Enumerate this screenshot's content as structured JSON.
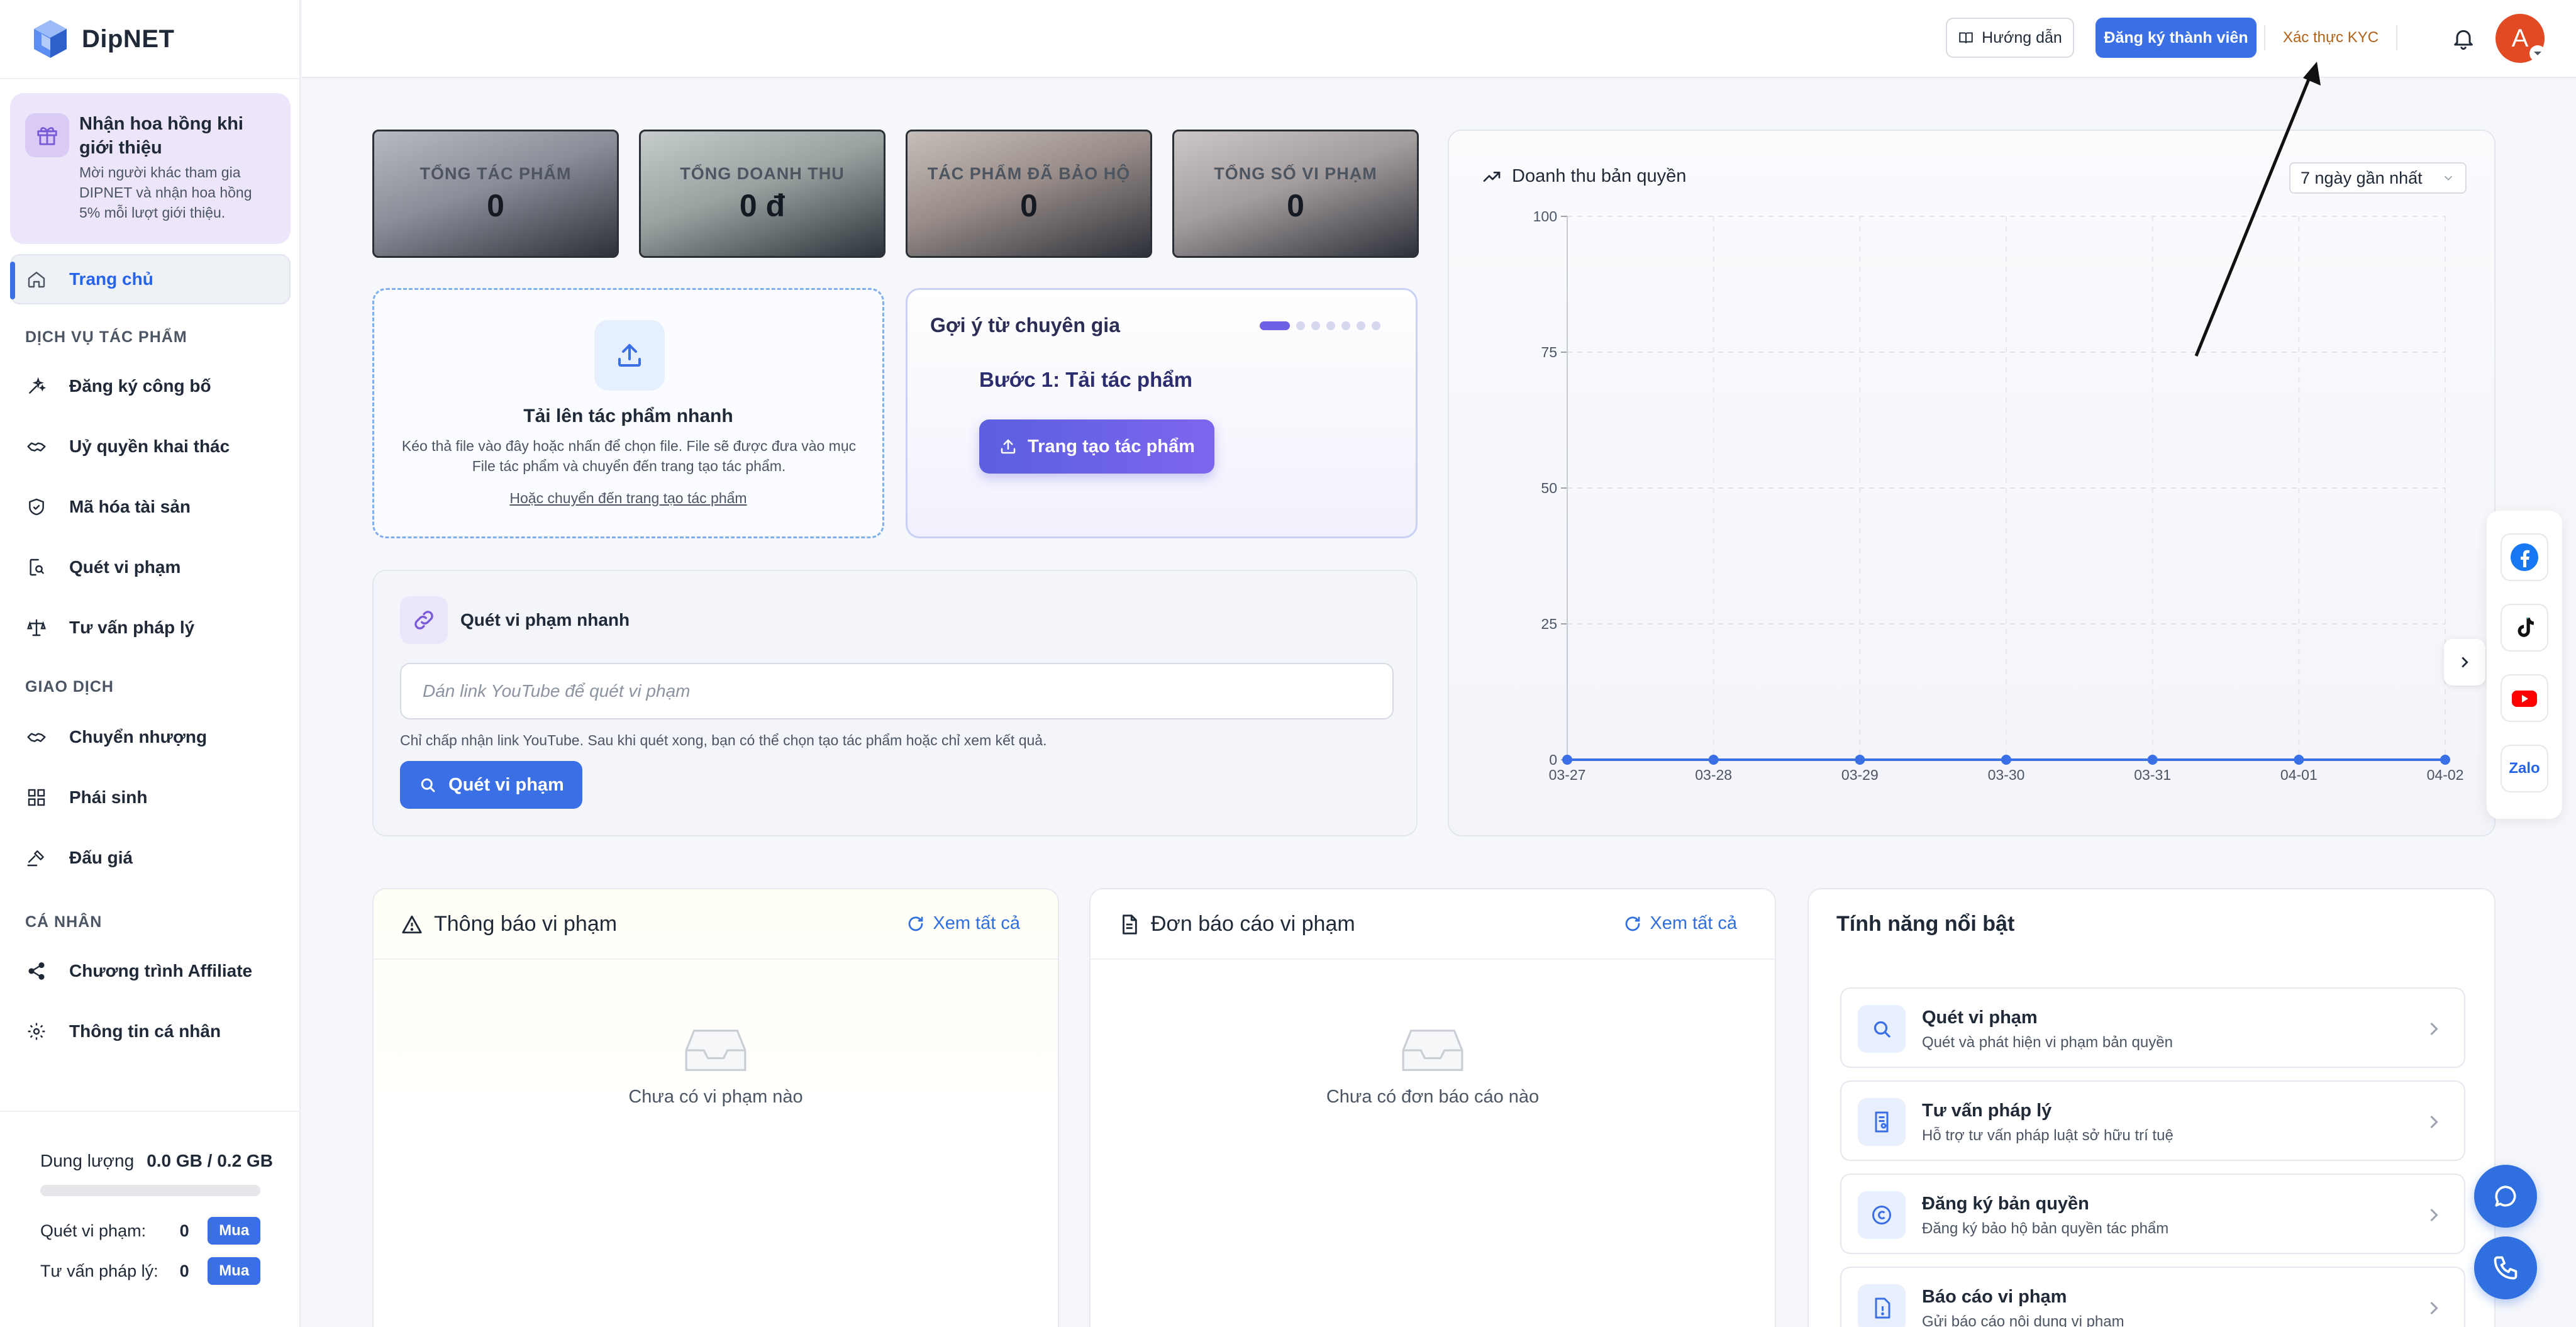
{
  "app": {
    "name": "DipNET"
  },
  "colors": {
    "primary": "#3b6fe6",
    "kyc": "#b0621a",
    "avatar": "#e24a24",
    "purple": "#6f61e6"
  },
  "sidebar": {
    "promo": {
      "title": "Nhận hoa hồng khi giới thiệu",
      "description": "Mời người khác tham gia DIPNET và nhận hoa hồng 5% mỗi lượt giới thiệu.",
      "icon": "gift-icon"
    },
    "home": {
      "label": "Trang chủ",
      "icon": "home-icon"
    },
    "sections": [
      {
        "title": "DỊCH VỤ TÁC PHẨM",
        "items": [
          {
            "label": "Đăng ký công bố",
            "icon": "sparkle-icon"
          },
          {
            "label": "Uỷ quyền khai thác",
            "icon": "handshake-icon"
          },
          {
            "label": "Mã hóa tài sản",
            "icon": "shield-icon"
          },
          {
            "label": "Quét vi phạm",
            "icon": "scan-icon"
          },
          {
            "label": "Tư vấn pháp lý",
            "icon": "scale-icon"
          }
        ]
      },
      {
        "title": "GIAO DỊCH",
        "items": [
          {
            "label": "Chuyển nhượng",
            "icon": "transfer-icon"
          },
          {
            "label": "Phái sinh",
            "icon": "grid-icon"
          },
          {
            "label": "Đấu giá",
            "icon": "gavel-icon"
          }
        ]
      },
      {
        "title": "CÁ NHÂN",
        "items": [
          {
            "label": "Chương trình Affiliate",
            "icon": "share-icon"
          },
          {
            "label": "Thông tin cá nhân",
            "icon": "gear-icon"
          }
        ]
      }
    ],
    "storage": {
      "label": "Dung lượng",
      "value": "0.0 GB / 0.2 GB",
      "used_fraction": 0.0
    },
    "quotas": [
      {
        "label": "Quét vi phạm:",
        "value": "0",
        "button": "Mua"
      },
      {
        "label": "Tư vấn pháp lý:",
        "value": "0",
        "button": "Mua"
      }
    ]
  },
  "topbar": {
    "guide_label": "Hướng dẫn",
    "register_label": "Đăng ký thành viên",
    "kyc_label": "Xác thực KYC",
    "avatar_letter": "A"
  },
  "stats": [
    {
      "label": "TỔNG TÁC PHẨM",
      "value": "0"
    },
    {
      "label": "TỔNG DOANH THU",
      "value": "0 đ"
    },
    {
      "label": "TÁC PHẨM ĐÃ BẢO HỘ",
      "value": "0"
    },
    {
      "label": "TỔNG SỐ VI PHẠM",
      "value": "0"
    }
  ],
  "upload": {
    "title": "Tải lên tác phẩm nhanh",
    "description": "Kéo thả file vào đây hoặc nhấn để chọn file. File sẽ được đưa vào mục File tác phẩm và chuyển đến trang tạo tác phẩm.",
    "link": "Hoặc chuyển đến trang tạo tác phẩm"
  },
  "expert": {
    "title": "Gợi ý từ chuyên gia",
    "step": "Bước 1: Tải tác phẩm",
    "button": "Trang tạo tác phẩm",
    "dots_total": 7,
    "dots_active": 0
  },
  "scan": {
    "title": "Quét vi phạm nhanh",
    "placeholder": "Dán link YouTube để quét vi phạm",
    "value": "",
    "hint": "Chỉ chấp nhận link YouTube. Sau khi quét xong, bạn có thể chọn tạo tác phẩm hoặc chỉ xem kết quả.",
    "button": "Quét vi phạm"
  },
  "chart": {
    "title": "Doanh thu bản quyền",
    "range_label": "7 ngày gần nhất"
  },
  "chart_data": {
    "type": "line",
    "title": "Doanh thu bản quyền",
    "x": [
      "03-27",
      "03-28",
      "03-29",
      "03-30",
      "03-31",
      "04-01",
      "04-02"
    ],
    "series": [
      {
        "values": [
          0,
          0,
          0,
          0,
          0,
          0,
          0
        ]
      }
    ],
    "ylim": [
      0,
      100
    ],
    "yticks": [
      0,
      25,
      50,
      75,
      100
    ],
    "grid": true,
    "color": "#3b6fe6"
  },
  "social": [
    {
      "name": "facebook-icon"
    },
    {
      "name": "tiktok-icon"
    },
    {
      "name": "youtube-icon"
    },
    {
      "name": "zalo-icon",
      "label": "Zalo"
    }
  ],
  "panels": {
    "violations": {
      "title": "Thông báo vi phạm",
      "link": "Xem tất cả",
      "empty": "Chưa có vi phạm nào"
    },
    "reports": {
      "title": "Đơn báo cáo vi phạm",
      "link": "Xem tất cả",
      "empty": "Chưa có đơn báo cáo nào"
    },
    "features": {
      "title": "Tính năng nổi bật",
      "items": [
        {
          "title": "Quét vi phạm",
          "desc": "Quét và phát hiện vi phạm bản quyền",
          "icon": "search-icon"
        },
        {
          "title": "Tư vấn pháp lý",
          "desc": "Hỗ trợ tư vấn pháp luật sở hữu trí tuệ",
          "icon": "legal-doc-icon"
        },
        {
          "title": "Đăng ký bản quyền",
          "desc": "Đăng ký bảo hộ bản quyền tác phẩm",
          "icon": "copyright-icon"
        },
        {
          "title": "Báo cáo vi phạm",
          "desc": "Gửi báo cáo nội dung vi phạm",
          "icon": "report-icon"
        }
      ]
    }
  }
}
